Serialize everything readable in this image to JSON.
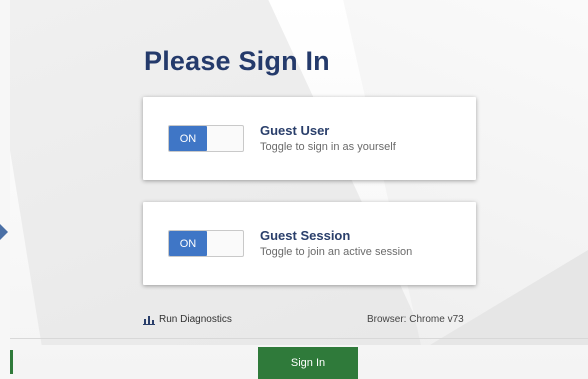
{
  "page": {
    "title": "Please Sign In"
  },
  "cards": [
    {
      "toggle_label": "ON",
      "title": "Guest User",
      "subtitle": "Toggle to sign in as yourself"
    },
    {
      "toggle_label": "ON",
      "title": "Guest Session",
      "subtitle": "Toggle to join an active session"
    }
  ],
  "footer": {
    "diagnostics_label": "Run Diagnostics",
    "diagnostics_icon": "bar-chart-icon",
    "browser_info": "Browser: Chrome v73"
  },
  "actions": {
    "signin_label": "Sign In"
  },
  "colors": {
    "title": "#243a6b",
    "toggle_on": "#3f76c6",
    "primary_button": "#2f7a3a",
    "arrow": "#4a6fa5"
  }
}
